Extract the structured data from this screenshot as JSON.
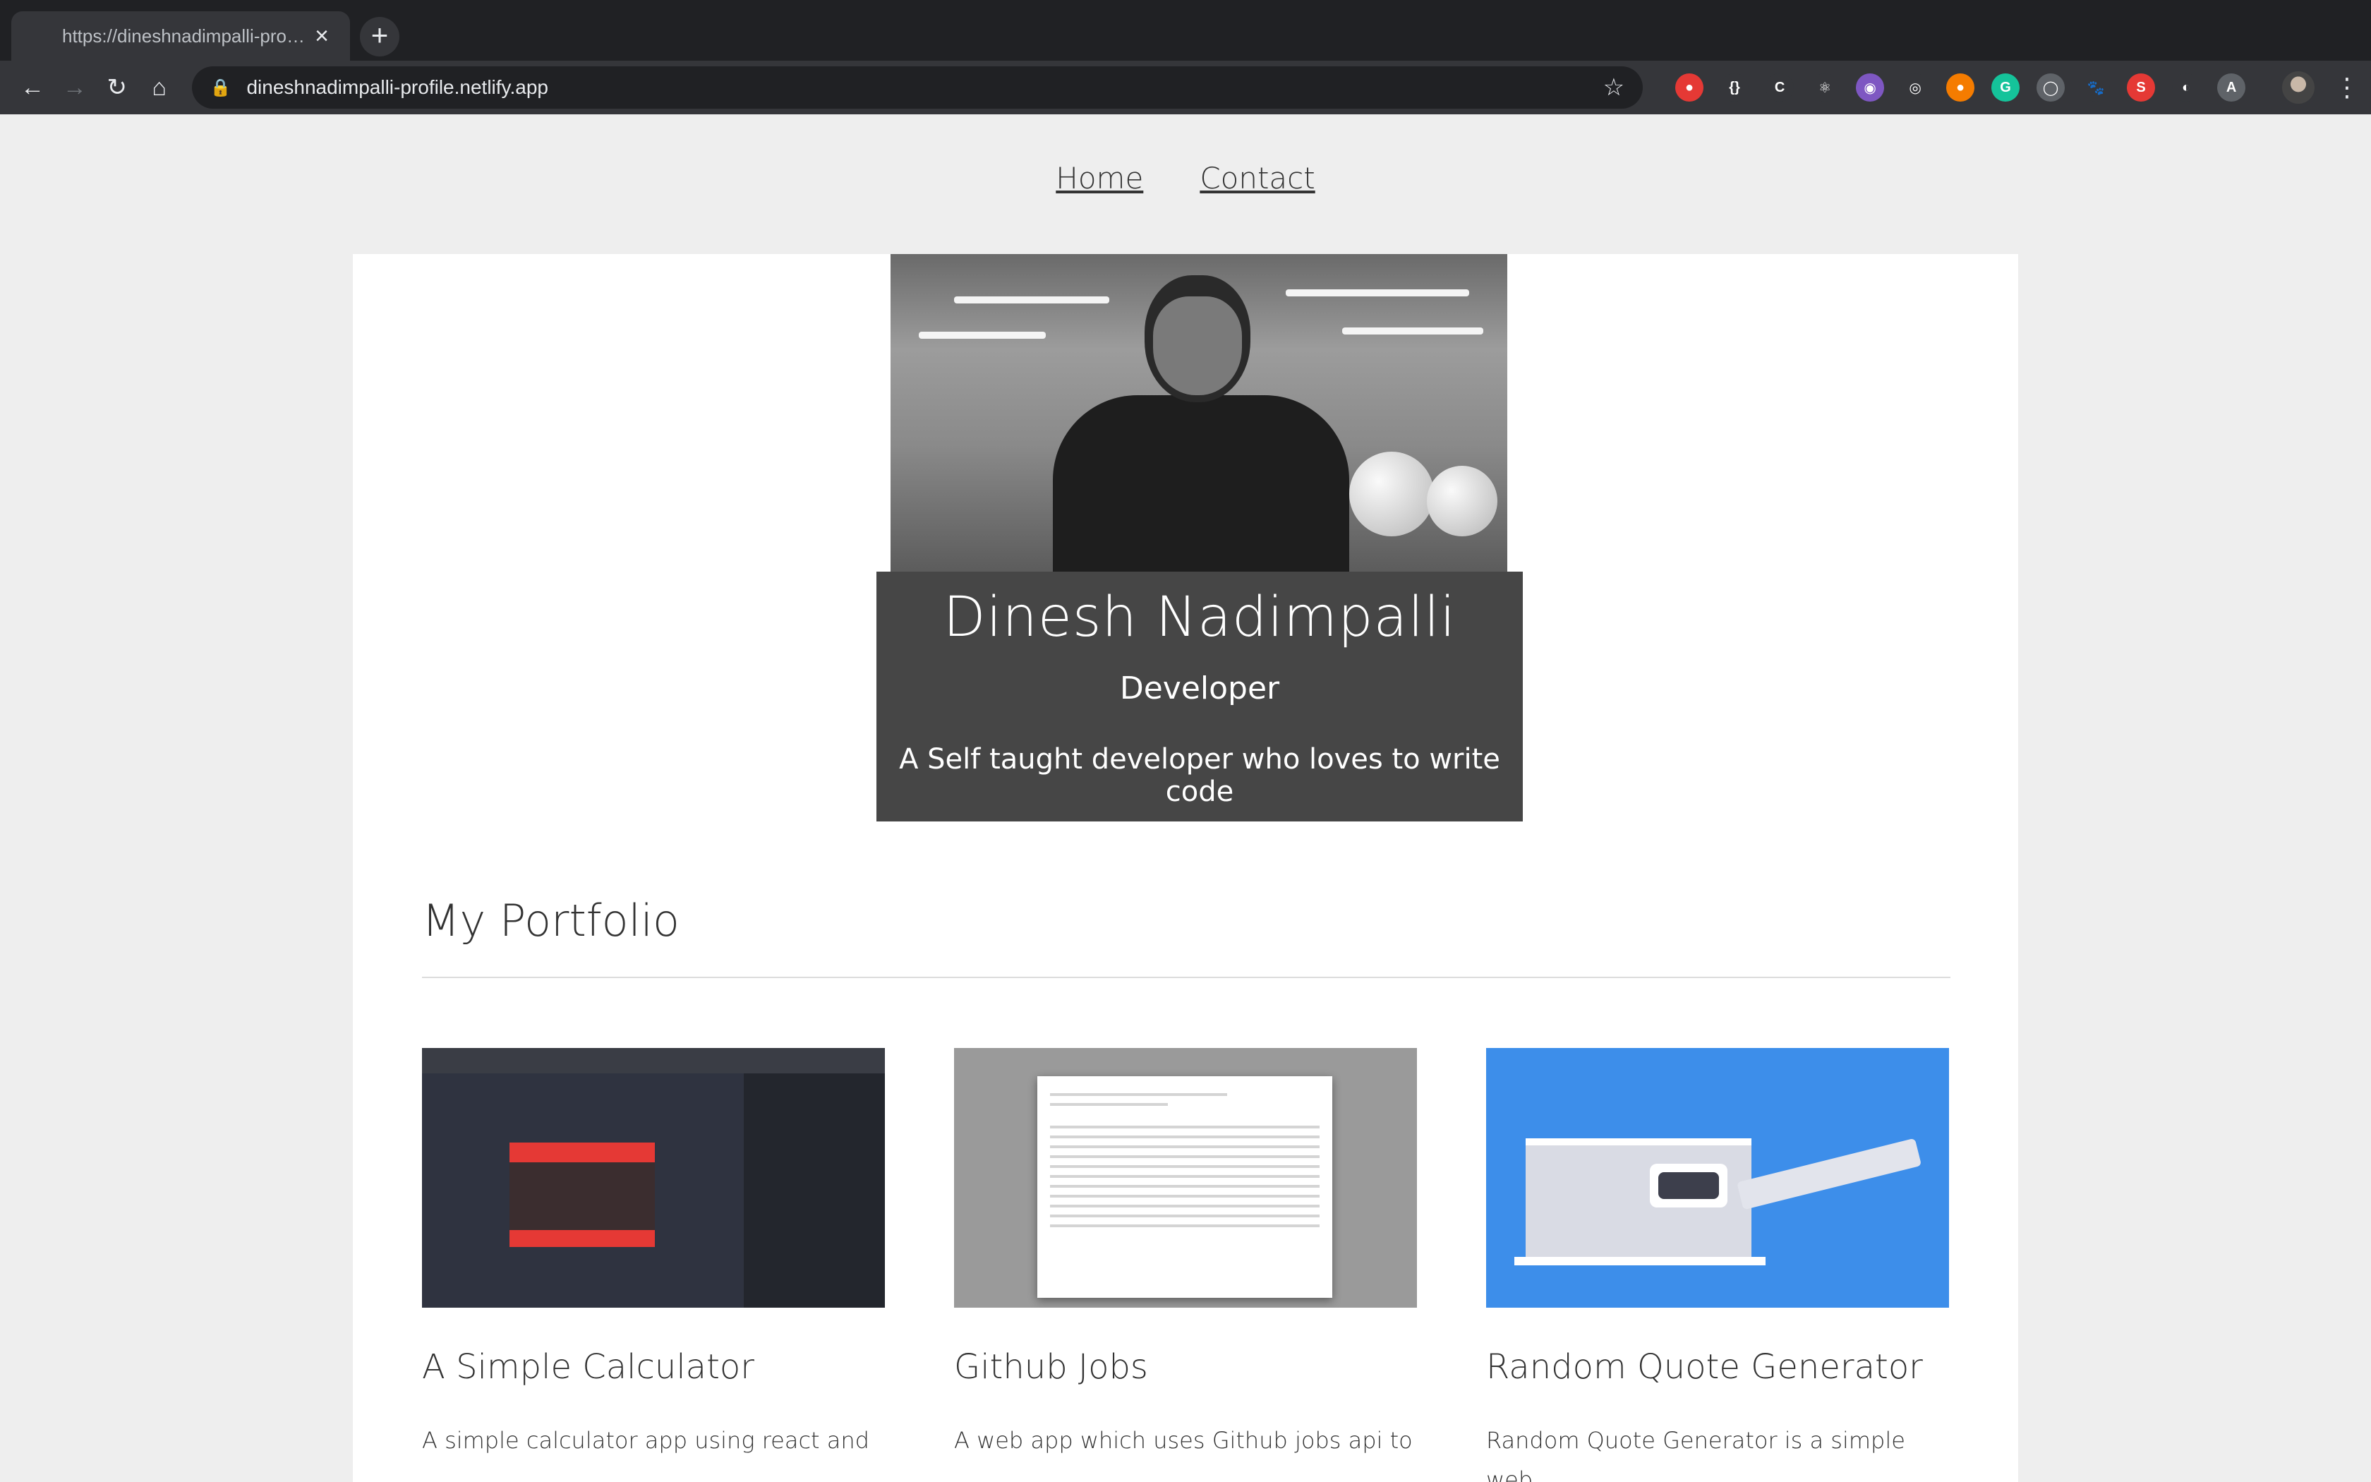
{
  "browser": {
    "tab_title": "https://dineshnadimpalli-profile.netlify.app",
    "tab_close": "×",
    "new_tab": "+",
    "url": "dineshnadimpalli-profile.netlify.app",
    "back": "←",
    "forward": "→",
    "reload": "↻",
    "home": "⌂",
    "lock": "🔒",
    "star": "☆",
    "menu": "⋮"
  },
  "nav": {
    "home": "Home",
    "contact": "Contact"
  },
  "hero": {
    "name": "Dinesh Nadimpalli",
    "role": "Developer",
    "tagline": "A Self taught developer who loves to write code"
  },
  "portfolio": {
    "title": "My Portfolio",
    "projects": [
      {
        "title": "A Simple Calculator",
        "description": "A simple calculator app using react and"
      },
      {
        "title": "Github Jobs",
        "description": "A web app which uses Github jobs api to"
      },
      {
        "title": "Random Quote Generator",
        "description": "Random Quote Generator is a simple web"
      }
    ]
  },
  "extensions": [
    {
      "icon": "adblock-icon",
      "color": "#e53935",
      "glyph": "●"
    },
    {
      "icon": "json-icon",
      "color": "#35363a",
      "glyph": "{}"
    },
    {
      "icon": "css-peeper-icon",
      "color": "#35363a",
      "glyph": "C"
    },
    {
      "icon": "react-devtools-icon",
      "color": "#35363a",
      "glyph": "⚛"
    },
    {
      "icon": "purple-extension-icon",
      "color": "#7e57c2",
      "glyph": "◉"
    },
    {
      "icon": "target-icon",
      "color": "#35363a",
      "glyph": "◎"
    },
    {
      "icon": "honey-icon",
      "color": "#f57c00",
      "glyph": "●"
    },
    {
      "icon": "grammarly-icon",
      "color": "#15c39a",
      "glyph": "G"
    },
    {
      "icon": "grey-circle-icon",
      "color": "#5f6368",
      "glyph": "◯"
    },
    {
      "icon": "paw-icon",
      "color": "#35363a",
      "glyph": "🐾"
    },
    {
      "icon": "s-extension-icon",
      "color": "#e53935",
      "glyph": "S"
    },
    {
      "icon": "toggle-extension-icon",
      "color": "#35363a",
      "glyph": "◐"
    },
    {
      "icon": "reader-extension-icon",
      "color": "#5f6368",
      "glyph": "A"
    }
  ]
}
